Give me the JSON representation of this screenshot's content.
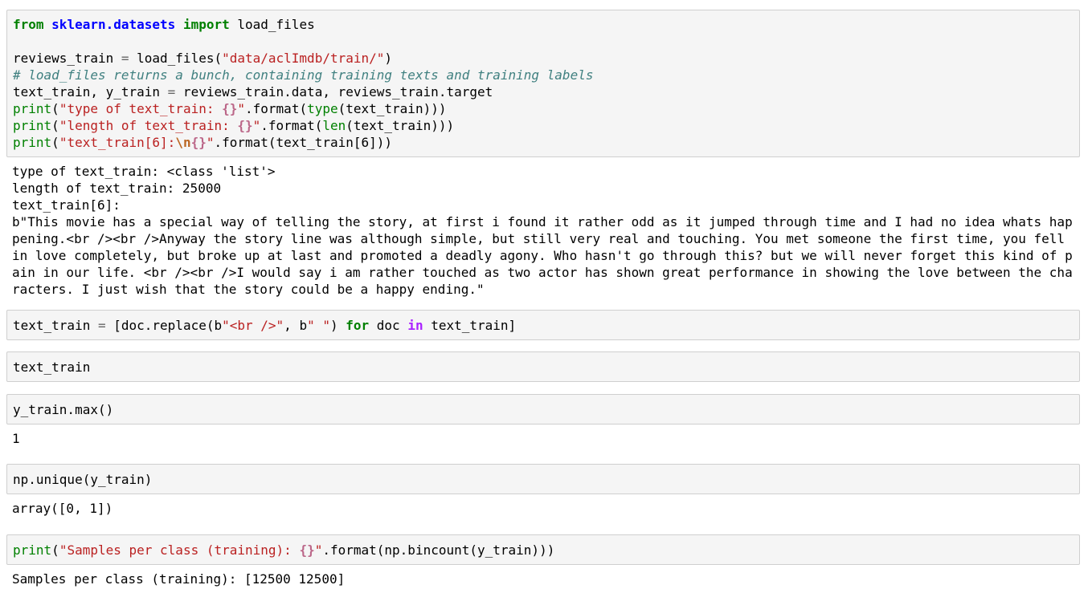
{
  "cells": [
    {
      "input": {
        "line1": {
          "from": "from",
          "module": "sklearn.datasets",
          "import": "import",
          "name": "load_files"
        },
        "line3": {
          "pre": "reviews_train ",
          "eq": "=",
          "call": " load_files(",
          "str": "\"data/aclImdb/train/\"",
          "post": ")"
        },
        "line4": {
          "comment": "# load_files returns a bunch, containing training texts and training labels"
        },
        "line5": {
          "pre": "text_train, y_train ",
          "eq": "=",
          "post": " reviews_train.data, reviews_train.target"
        },
        "line6": {
          "print": "print",
          "open": "(",
          "str": "\"type of text_train: ",
          "fmt": "{}",
          "strend": "\"",
          "mid": ".format(",
          "fn": "type",
          "post": "(text_train)))"
        },
        "line7": {
          "print": "print",
          "open": "(",
          "str": "\"length of text_train: ",
          "fmt": "{}",
          "strend": "\"",
          "mid": ".format(",
          "fn": "len",
          "post": "(text_train)))"
        },
        "line8": {
          "print": "print",
          "open": "(",
          "str": "\"text_train[6]:",
          "esc": "\\n",
          "fmt": "{}",
          "strend": "\"",
          "post": ".format(text_train[6]))"
        }
      },
      "output": [
        "type of text_train: <class 'list'>",
        "length of text_train: 25000",
        "text_train[6]:",
        "b\"This movie has a special way of telling the story, at first i found it rather odd as it jumped through time and I had no idea whats hap",
        "pening.<br /><br />Anyway the story line was although simple, but still very real and touching. You met someone the first time, you fell",
        "in love completely, but broke up at last and promoted a deadly agony. Who hasn't go through this? but we will never forget this kind of p",
        "ain in our life. <br /><br />I would say i am rather touched as two actor has shown great performance in showing the love between the cha",
        "racters. I just wish that the story could be a happy ending.\""
      ]
    },
    {
      "input": {
        "pre": "text_train ",
        "eq": "=",
        "mid1": " [doc.replace(b",
        "str1": "\"<br />\"",
        "mid2": ", b",
        "str2": "\" \"",
        "mid3": ") ",
        "for": "for",
        "mid4": " doc ",
        "in": "in",
        "post": " text_train]"
      }
    },
    {
      "input": {
        "text": "text_train"
      }
    },
    {
      "input": {
        "text": "y_train.max()"
      },
      "output": "1"
    },
    {
      "input": {
        "text": "np.unique(y_train)"
      },
      "output": "array([0, 1])"
    },
    {
      "input": {
        "print": "print",
        "open": "(",
        "str": "\"Samples per class (training): ",
        "fmt": "{}",
        "strend": "\"",
        "post": ".format(np.bincount(y_train)))"
      },
      "output": "Samples per class (training): [12500 12500]"
    }
  ]
}
